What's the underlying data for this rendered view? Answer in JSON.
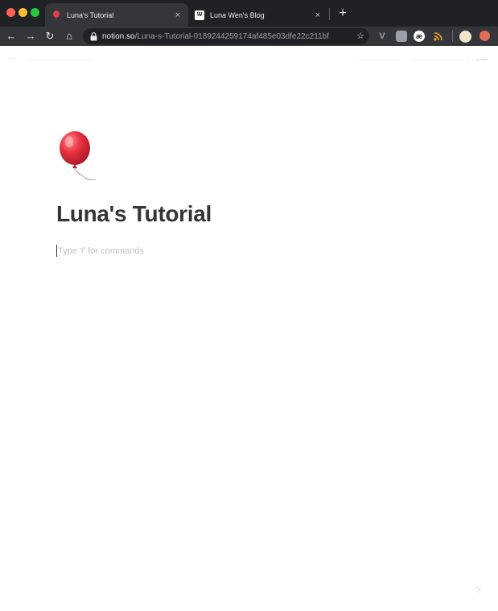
{
  "browser": {
    "tabs": [
      {
        "title": "Luna's Tutorial",
        "close": "×",
        "active": true
      },
      {
        "title": "Luna Wen's Blog",
        "close": "×",
        "active": false,
        "favicon_text": "W"
      }
    ],
    "new_tab": "+",
    "nav": {
      "back": "←",
      "forward": "→",
      "reload": "↻",
      "home": "⌂"
    },
    "url": {
      "host": "notion.so",
      "path": "/Luna-s-Tutorial-0189244259174af485e03dfe22c211bf"
    },
    "bookmark_icon": "☆",
    "extensions": [
      {
        "name": "vue-devtools-icon",
        "text": "V",
        "color": "#9aa0a6"
      },
      {
        "name": "extension-grey-icon",
        "text": "",
        "color": "#9aa0a6"
      },
      {
        "name": "ae-extension-icon",
        "text": "æ",
        "color": "#ffffff"
      },
      {
        "name": "rss-icon",
        "text": "",
        "color": "#f5a623"
      },
      {
        "name": "profile-avatar-icon",
        "text": "",
        "color": "#f1e5c8"
      },
      {
        "name": "extension-red-icon",
        "text": "",
        "color": "#e06c5a"
      }
    ]
  },
  "page": {
    "title": "Luna's Tutorial",
    "placeholder": "Type '/' for commands",
    "help": "?",
    "accent": "#37352f"
  }
}
